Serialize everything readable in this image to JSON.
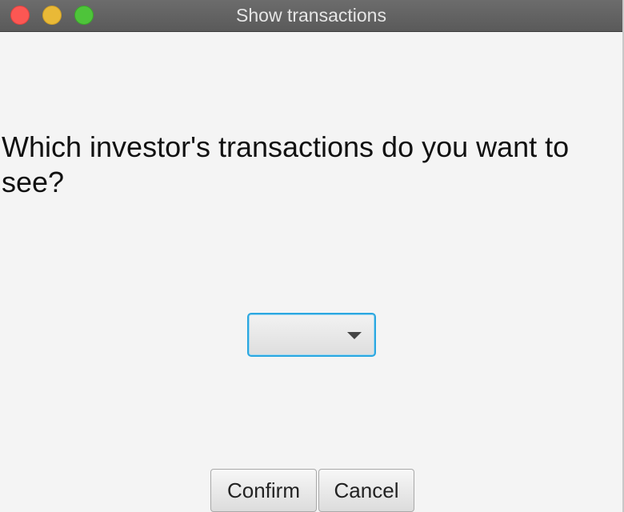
{
  "window": {
    "title": "Show transactions"
  },
  "dialog": {
    "question": "Which investor's transactions do you want to see?",
    "investor_select": {
      "selected_value": "",
      "icon": "chevron-down-icon"
    }
  },
  "buttons": {
    "confirm_label": "Confirm",
    "cancel_label": "Cancel"
  },
  "colors": {
    "titlebar": "#5f5f5f",
    "background": "#f4f4f4",
    "focus_ring": "#2aa7e0",
    "close": "#fc5753",
    "minimize": "#e9b937",
    "zoom": "#4ec43a"
  }
}
